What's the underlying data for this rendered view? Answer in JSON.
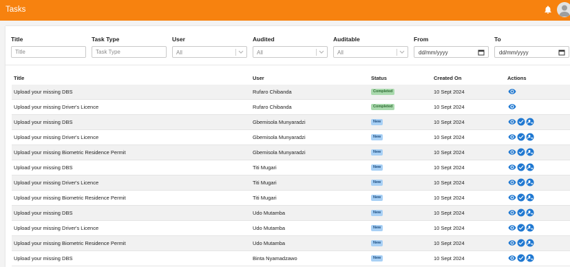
{
  "app": {
    "title": "Tasks"
  },
  "filters": {
    "title_label": "Title",
    "title_placeholder": "Title",
    "task_type_label": "Task Type",
    "task_type_placeholder": "Task Type",
    "user_label": "User",
    "user_value": "All",
    "audited_label": "Audited",
    "audited_value": "All",
    "auditable_label": "Auditable",
    "auditable_value": "All",
    "from_label": "From",
    "from_value": "dd/mm/yyyy",
    "to_label": "To",
    "to_value": "dd/mm/yyyy"
  },
  "table": {
    "columns": {
      "title": "Title",
      "user": "User",
      "status": "Status",
      "created_on": "Created On",
      "actions": "Actions"
    },
    "rows": [
      {
        "title": "Upload your missing DBS",
        "user": "Rufaro Chibanda",
        "status": "Completed",
        "created_on": "10 Sept 2024",
        "actions": [
          "view"
        ]
      },
      {
        "title": "Upload your missing Driver's Licence",
        "user": "Rufaro Chibanda",
        "status": "Completed",
        "created_on": "10 Sept 2024",
        "actions": [
          "view"
        ]
      },
      {
        "title": "Upload your missing DBS",
        "user": "Gbemisola Munyaradzi",
        "status": "New",
        "created_on": "10 Sept 2024",
        "actions": [
          "view",
          "approve",
          "reassign"
        ]
      },
      {
        "title": "Upload your missing Driver's Licence",
        "user": "Gbemisola Munyaradzi",
        "status": "New",
        "created_on": "10 Sept 2024",
        "actions": [
          "view",
          "approve",
          "reassign"
        ]
      },
      {
        "title": "Upload your missing Biometric Residence Permit",
        "user": "Gbemisola Munyaradzi",
        "status": "New",
        "created_on": "10 Sept 2024",
        "actions": [
          "view",
          "approve",
          "reassign"
        ]
      },
      {
        "title": "Upload your missing DBS",
        "user": "Titi Mugari",
        "status": "New",
        "created_on": "10 Sept 2024",
        "actions": [
          "view",
          "approve",
          "reassign"
        ]
      },
      {
        "title": "Upload your missing Driver's Licence",
        "user": "Titi Mugari",
        "status": "New",
        "created_on": "10 Sept 2024",
        "actions": [
          "view",
          "approve",
          "reassign"
        ]
      },
      {
        "title": "Upload your missing Biometric Residence Permit",
        "user": "Titi Mugari",
        "status": "New",
        "created_on": "10 Sept 2024",
        "actions": [
          "view",
          "approve",
          "reassign"
        ]
      },
      {
        "title": "Upload your missing DBS",
        "user": "Udo Mutamba",
        "status": "New",
        "created_on": "10 Sept 2024",
        "actions": [
          "view",
          "approve",
          "reassign"
        ]
      },
      {
        "title": "Upload your missing Driver's Licence",
        "user": "Udo Mutamba",
        "status": "New",
        "created_on": "10 Sept 2024",
        "actions": [
          "view",
          "approve",
          "reassign"
        ]
      },
      {
        "title": "Upload your missing Biometric Residence Permit",
        "user": "Udo Mutamba",
        "status": "New",
        "created_on": "10 Sept 2024",
        "actions": [
          "view",
          "approve",
          "reassign"
        ]
      },
      {
        "title": "Upload your missing DBS",
        "user": "Binta Nyamadzawo",
        "status": "New",
        "created_on": "10 Sept 2024",
        "actions": [
          "view",
          "approve",
          "reassign"
        ]
      }
    ]
  },
  "colors": {
    "header": "#f7820f",
    "action": "#1f78d1",
    "completed_badge": "#a9d9ad",
    "new_badge": "#a8d0f5"
  },
  "icons": {
    "notification": "bell-icon",
    "profile": "user-avatar-icon",
    "view": "eye-icon",
    "approve": "check-circle-icon",
    "reassign": "reassign-icon"
  }
}
